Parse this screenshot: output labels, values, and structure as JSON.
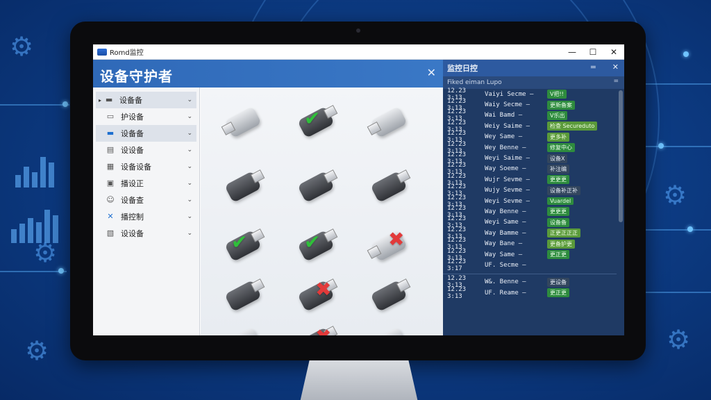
{
  "window": {
    "title": "Romd监控",
    "buttons": {
      "minimize": "—",
      "maximize": "☐",
      "close": "✕"
    }
  },
  "app": {
    "header_title": "设备守护者",
    "header_close": "✕",
    "sidebar": [
      {
        "label": "设备备",
        "icon": "device-icon",
        "active": true,
        "sub": false
      },
      {
        "label": "护设备",
        "icon": "protect-icon",
        "active": false,
        "sub": true
      },
      {
        "label": "设备备",
        "icon": "usb-icon",
        "active": true,
        "sub": true
      },
      {
        "label": "设设备",
        "icon": "list-icon",
        "active": false,
        "sub": true
      },
      {
        "label": "设备设备",
        "icon": "storage-icon",
        "active": false,
        "sub": true
      },
      {
        "label": "播设正",
        "icon": "record-icon",
        "active": false,
        "sub": true
      },
      {
        "label": "设备查",
        "icon": "user-icon",
        "active": false,
        "sub": true
      },
      {
        "label": "播控制",
        "icon": "block-icon",
        "active": false,
        "sub": true
      },
      {
        "label": "设设备",
        "icon": "settings-icon",
        "active": false,
        "sub": true
      }
    ],
    "devices": [
      {
        "style": "silver",
        "status": "none"
      },
      {
        "style": "dark",
        "status": "ok"
      },
      {
        "style": "silver",
        "status": "none"
      },
      {
        "style": "dark",
        "status": "none"
      },
      {
        "style": "dark",
        "status": "none"
      },
      {
        "style": "dark",
        "status": "none"
      },
      {
        "style": "dark",
        "status": "ok"
      },
      {
        "style": "dark",
        "status": "ok"
      },
      {
        "style": "silver",
        "status": "blocked"
      },
      {
        "style": "dark",
        "status": "none"
      },
      {
        "style": "dark",
        "status": "blocked"
      },
      {
        "style": "dark",
        "status": "none"
      },
      {
        "style": "silver",
        "status": "none"
      },
      {
        "style": "dark",
        "status": "blocked"
      },
      {
        "style": "silver",
        "status": "none"
      }
    ]
  },
  "log_panel": {
    "title": "监控日控",
    "minimize": "=",
    "close": "✕",
    "subtitle": "Fiked eiman Lupo",
    "sub_dash": "=",
    "rows": [
      {
        "time": "12.23 3:13",
        "source": "Vaiyi Secme",
        "tag": "V把!!",
        "tone": "ok"
      },
      {
        "time": "12.23 3:13",
        "source": "Waiy Secme",
        "tag": "更新备案",
        "tone": "ok"
      },
      {
        "time": "12.23 3:13",
        "source": "Wai Bamd",
        "tag": "V乐出",
        "tone": "ok"
      },
      {
        "time": "12.23 3:13",
        "source": "Weiy Saime",
        "tag": "检查 Secureduto",
        "tone": "info"
      },
      {
        "time": "12.23 3:13",
        "source": "Wey Same",
        "tag": "更多补",
        "tone": "info"
      },
      {
        "time": "12.23 3:13",
        "source": "Wey Benne",
        "tag": "修复中心",
        "tone": "ok"
      },
      {
        "time": "12.23 3:13",
        "source": "Weyi Saime",
        "tag": "设备X",
        "tone": "dark"
      },
      {
        "time": "12.23 3:13",
        "source": "Way Soeme",
        "tag": "补注编",
        "tone": "dark"
      },
      {
        "time": "12.23 3:13",
        "source": "Wujr Sevme",
        "tag": "更更更",
        "tone": "ok"
      },
      {
        "time": "12.23 3:13",
        "source": "Wujy Sevme",
        "tag": "设备补正补",
        "tone": "dark"
      },
      {
        "time": "12.23 3:13",
        "source": "Weyi Sevme",
        "tag": "Vuardel",
        "tone": "ok"
      },
      {
        "time": "12.23 3:13",
        "source": "Way Benne",
        "tag": "更更更",
        "tone": "ok"
      },
      {
        "time": "12.23 3:13",
        "source": "Weyi Same",
        "tag": "设备备",
        "tone": "ok"
      },
      {
        "time": "12.23 3:13",
        "source": "Way Bamme",
        "tag": "正更正正正",
        "tone": "info"
      },
      {
        "time": "12.23 3:13",
        "source": "Way Bane",
        "tag": "更备护更",
        "tone": "info"
      },
      {
        "time": "12.23 3:13",
        "source": "Way Same",
        "tag": "更正更",
        "tone": "ok"
      },
      {
        "time": "12.23 3:17",
        "source": "UF. Secme",
        "tag": "",
        "tone": "none"
      },
      {
        "time": "12.23 3:13",
        "source": "W&. Benne",
        "tag": "更设备",
        "tone": "dark"
      },
      {
        "time": "12.23 3:13",
        "source": "UF. Reame",
        "tag": "更正更",
        "tone": "ok"
      }
    ]
  }
}
